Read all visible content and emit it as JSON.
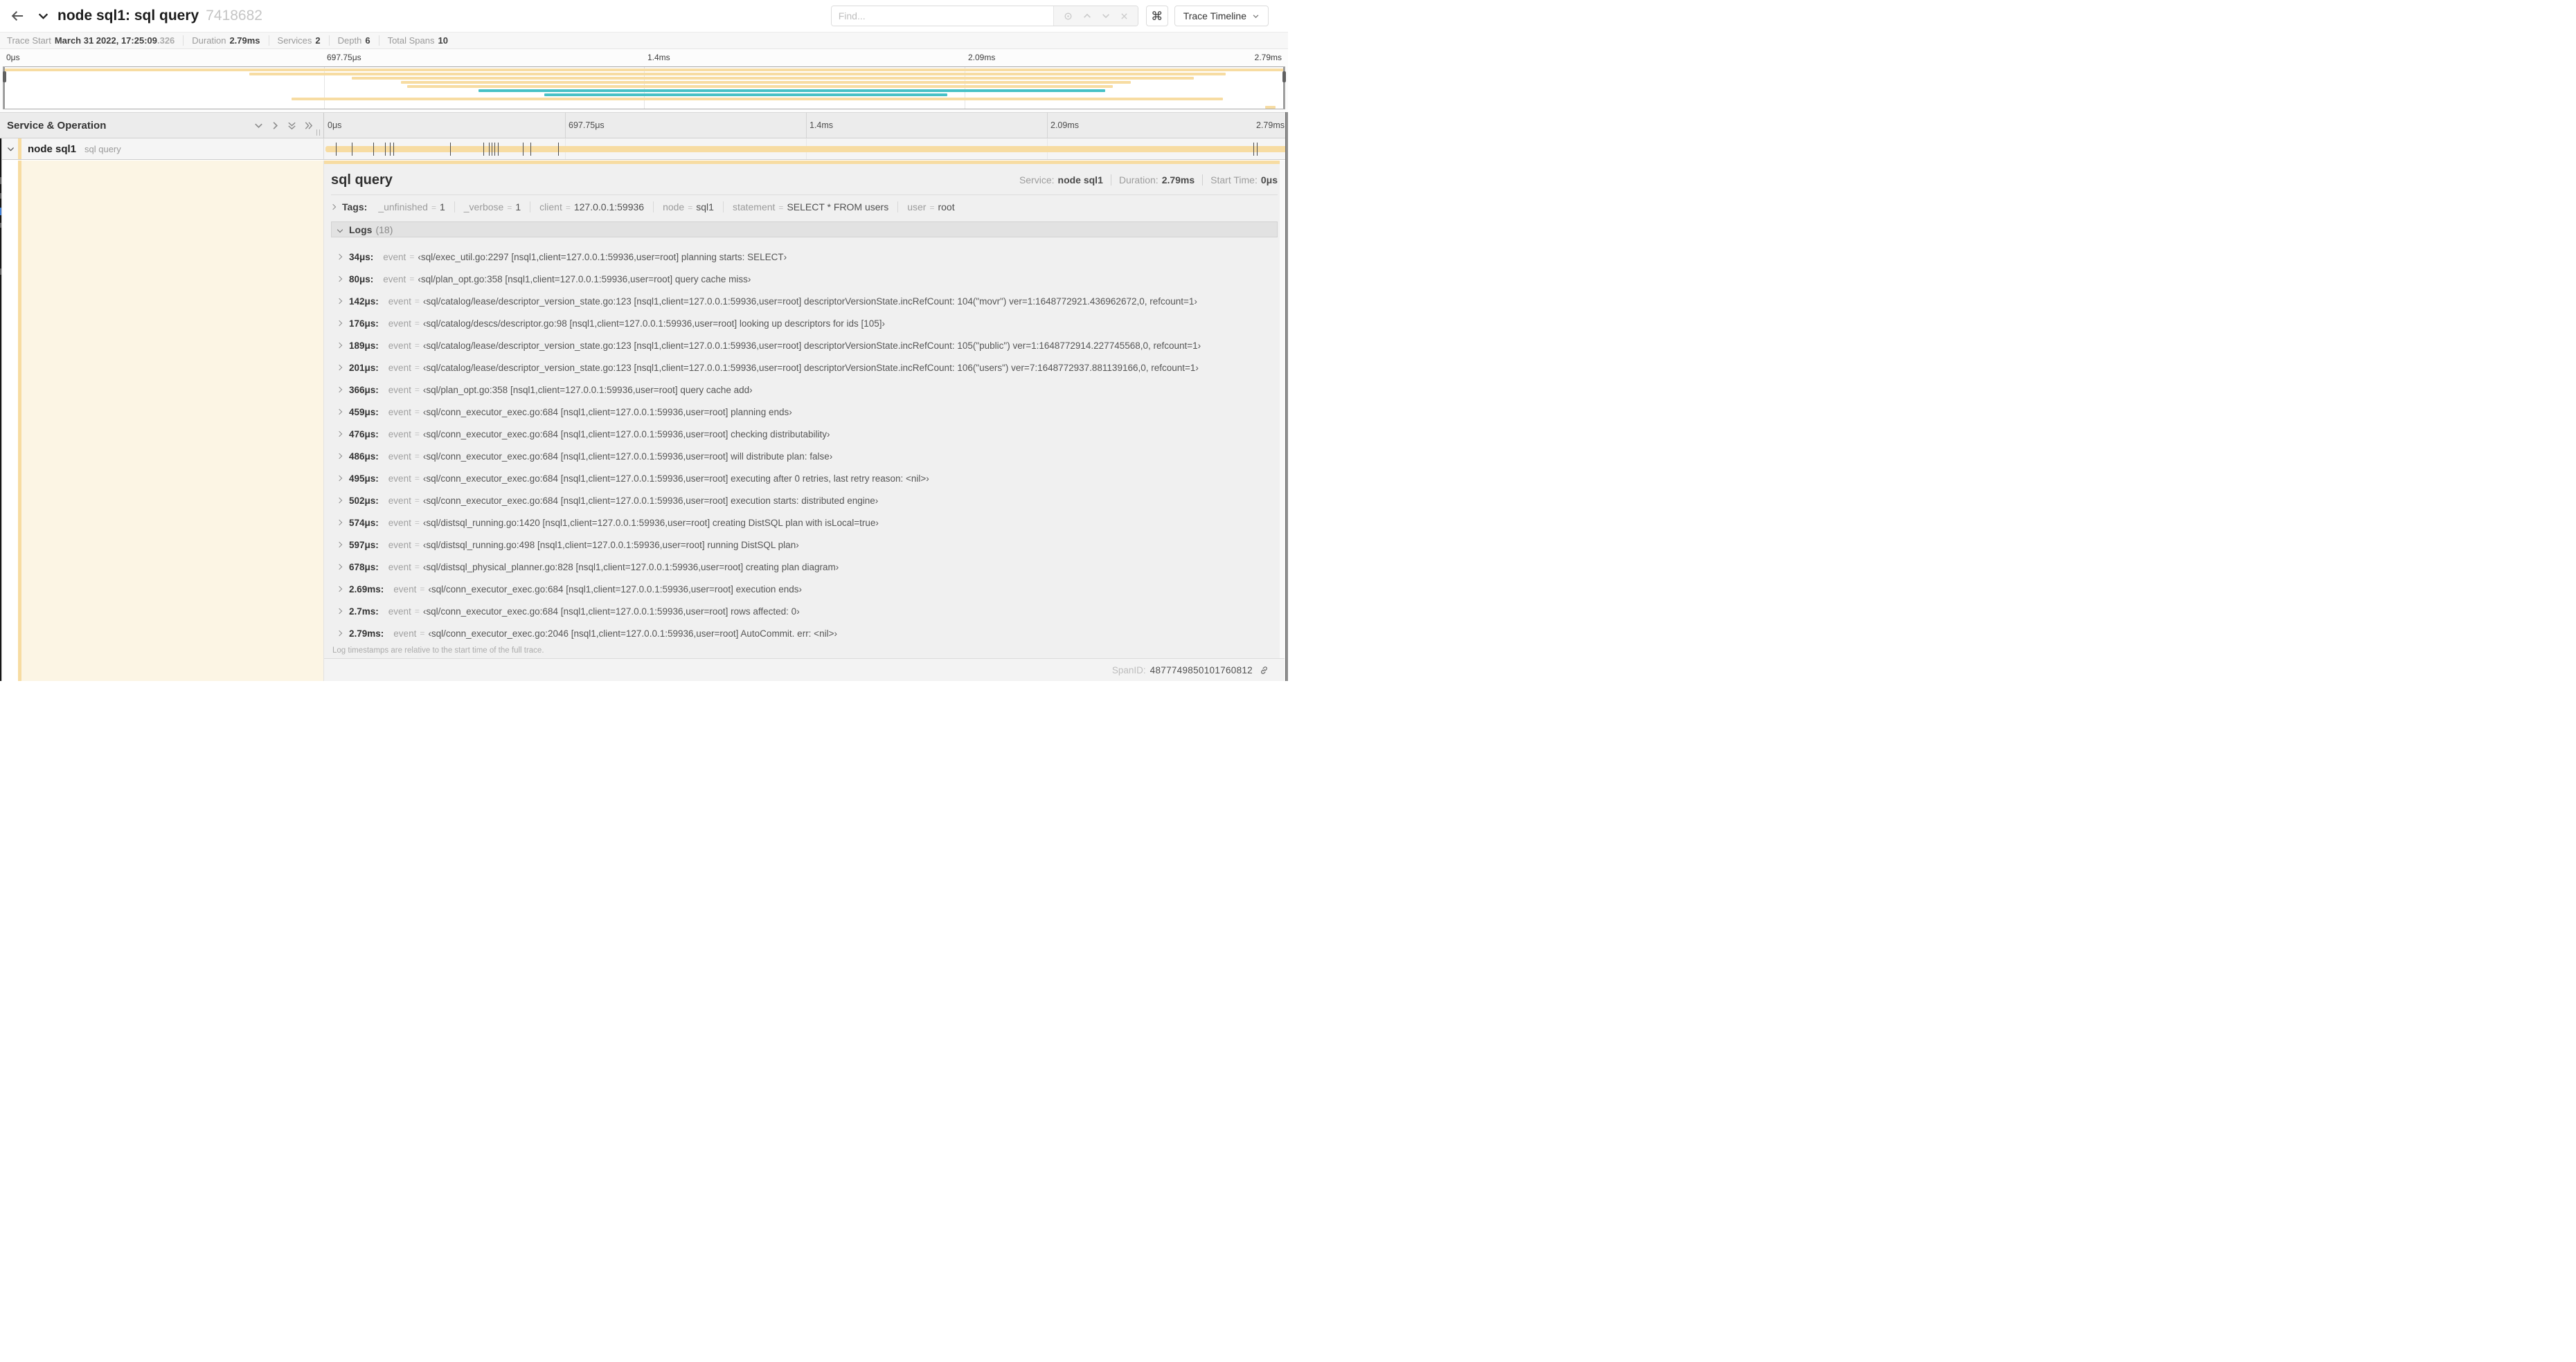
{
  "colors": {
    "span_tan": "#f7dca2",
    "span_teal": "#47c1c6",
    "selected_tint": "#fcf5e4"
  },
  "header": {
    "title": "node sql1: sql query",
    "trace_id": "7418682",
    "find_placeholder": "Find...",
    "shortcut_glyph": "⌘",
    "view_select_label": "Trace Timeline"
  },
  "stats": [
    {
      "label": "Trace Start",
      "value": "March 31 2022, 17:25:09",
      "suffix": ".326"
    },
    {
      "label": "Duration",
      "value": "2.79ms"
    },
    {
      "label": "Services",
      "value": "2"
    },
    {
      "label": "Depth",
      "value": "6"
    },
    {
      "label": "Total Spans",
      "value": "10"
    }
  ],
  "time_ticks": [
    {
      "label": "0μs",
      "pct": 0
    },
    {
      "label": "697.75μs",
      "pct": 25
    },
    {
      "label": "1.4ms",
      "pct": 50
    },
    {
      "label": "2.09ms",
      "pct": 75
    },
    {
      "label": "2.79ms",
      "pct": 100
    }
  ],
  "timeline": {
    "column_header": "Service & Operation",
    "grid_pct": [
      25,
      50,
      75
    ]
  },
  "minimap": {
    "spans": [
      {
        "row": 0,
        "s": 0,
        "e": 100,
        "c": "#f7dca2"
      },
      {
        "row": 1,
        "s": 19.2,
        "e": 95.4,
        "c": "#f7dca2"
      },
      {
        "row": 2,
        "s": 27.2,
        "e": 92.9,
        "c": "#f7dca2"
      },
      {
        "row": 3,
        "s": 31.0,
        "e": 88.0,
        "c": "#f7dca2"
      },
      {
        "row": 4,
        "s": 31.5,
        "e": 86.6,
        "c": "#f7dca2"
      },
      {
        "row": 5,
        "s": 37.1,
        "e": 86.0,
        "c": "#47c1c6"
      },
      {
        "row": 6,
        "s": 42.2,
        "e": 73.7,
        "c": "#47c1c6"
      },
      {
        "row": 7,
        "s": 22.5,
        "e": 95.2,
        "c": "#f7dca2"
      },
      {
        "row": 9,
        "s": 98.5,
        "e": 99.3,
        "c": "#f7dca2"
      }
    ]
  },
  "span_row": {
    "service": "node sql1",
    "operation": "sql query",
    "bar": {
      "start_pct": 0.15,
      "end_pct": 100
    },
    "log_marker_pct": [
      1.2,
      2.9,
      5.1,
      6.3,
      6.8,
      7.2,
      13.1,
      16.5,
      17.1,
      17.4,
      17.7,
      18.0,
      20.6,
      21.4,
      24.3,
      96.4,
      96.8,
      99.9
    ]
  },
  "detail": {
    "title": "sql query",
    "meta": [
      {
        "label": "Service:",
        "value": "node sql1"
      },
      {
        "label": "Duration:",
        "value": "2.79ms"
      },
      {
        "label": "Start Time:",
        "value": "0μs"
      }
    ],
    "tags_label": "Tags:",
    "tags": [
      {
        "key": "_unfinished",
        "value": "1"
      },
      {
        "key": "_verbose",
        "value": "1"
      },
      {
        "key": "client",
        "value": "127.0.0.1:59936"
      },
      {
        "key": "node",
        "value": "sql1"
      },
      {
        "key": "statement",
        "value": "SELECT * FROM users"
      },
      {
        "key": "user",
        "value": "root"
      }
    ],
    "logs_label": "Logs",
    "logs_count": "(18)",
    "log_rows": [
      {
        "time": "34μs:",
        "key": "event",
        "value": "‹sql/exec_util.go:2297 [nsql1,client=127.0.0.1:59936,user=root] planning starts: SELECT›"
      },
      {
        "time": "80μs:",
        "key": "event",
        "value": "‹sql/plan_opt.go:358 [nsql1,client=127.0.0.1:59936,user=root] query cache miss›"
      },
      {
        "time": "142μs:",
        "key": "event",
        "value": "‹sql/catalog/lease/descriptor_version_state.go:123 [nsql1,client=127.0.0.1:59936,user=root] descriptorVersionState.incRefCount: 104(\"movr\") ver=1:1648772921.436962672,0, refcount=1›"
      },
      {
        "time": "176μs:",
        "key": "event",
        "value": "‹sql/catalog/descs/descriptor.go:98 [nsql1,client=127.0.0.1:59936,user=root] looking up descriptors for ids [105]›"
      },
      {
        "time": "189μs:",
        "key": "event",
        "value": "‹sql/catalog/lease/descriptor_version_state.go:123 [nsql1,client=127.0.0.1:59936,user=root] descriptorVersionState.incRefCount: 105(\"public\") ver=1:1648772914.227745568,0, refcount=1›"
      },
      {
        "time": "201μs:",
        "key": "event",
        "value": "‹sql/catalog/lease/descriptor_version_state.go:123 [nsql1,client=127.0.0.1:59936,user=root] descriptorVersionState.incRefCount: 106(\"users\") ver=7:1648772937.881139166,0, refcount=1›"
      },
      {
        "time": "366μs:",
        "key": "event",
        "value": "‹sql/plan_opt.go:358 [nsql1,client=127.0.0.1:59936,user=root] query cache add›"
      },
      {
        "time": "459μs:",
        "key": "event",
        "value": "‹sql/conn_executor_exec.go:684 [nsql1,client=127.0.0.1:59936,user=root] planning ends›"
      },
      {
        "time": "476μs:",
        "key": "event",
        "value": "‹sql/conn_executor_exec.go:684 [nsql1,client=127.0.0.1:59936,user=root] checking distributability›"
      },
      {
        "time": "486μs:",
        "key": "event",
        "value": "‹sql/conn_executor_exec.go:684 [nsql1,client=127.0.0.1:59936,user=root] will distribute plan: false›"
      },
      {
        "time": "495μs:",
        "key": "event",
        "value": "‹sql/conn_executor_exec.go:684 [nsql1,client=127.0.0.1:59936,user=root] executing after 0 retries, last retry reason: <nil>›"
      },
      {
        "time": "502μs:",
        "key": "event",
        "value": "‹sql/conn_executor_exec.go:684 [nsql1,client=127.0.0.1:59936,user=root] execution starts: distributed engine›"
      },
      {
        "time": "574μs:",
        "key": "event",
        "value": "‹sql/distsql_running.go:1420 [nsql1,client=127.0.0.1:59936,user=root] creating DistSQL plan with isLocal=true›"
      },
      {
        "time": "597μs:",
        "key": "event",
        "value": "‹sql/distsql_running.go:498 [nsql1,client=127.0.0.1:59936,user=root] running DistSQL plan›"
      },
      {
        "time": "678μs:",
        "key": "event",
        "value": "‹sql/distsql_physical_planner.go:828 [nsql1,client=127.0.0.1:59936,user=root] creating plan diagram›"
      },
      {
        "time": "2.69ms:",
        "key": "event",
        "value": "‹sql/conn_executor_exec.go:684 [nsql1,client=127.0.0.1:59936,user=root] execution ends›"
      },
      {
        "time": "2.7ms:",
        "key": "event",
        "value": "‹sql/conn_executor_exec.go:684 [nsql1,client=127.0.0.1:59936,user=root] rows affected: 0›"
      },
      {
        "time": "2.79ms:",
        "key": "event",
        "value": "‹sql/conn_executor_exec.go:2046 [nsql1,client=127.0.0.1:59936,user=root] AutoCommit. err: <nil>›"
      }
    ],
    "footnote": "Log timestamps are relative to the start time of the full trace.",
    "spanid_label": "SpanID:",
    "spanid_value": "4877749850101760812"
  }
}
